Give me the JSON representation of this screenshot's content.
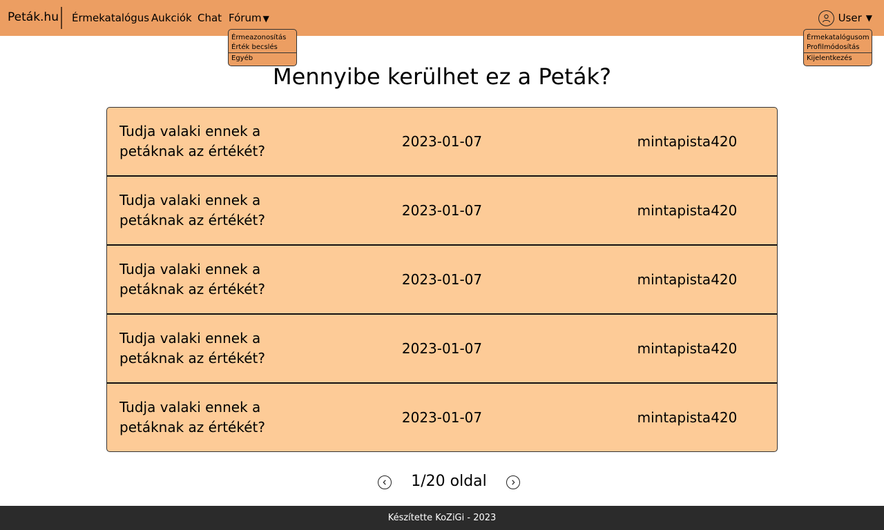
{
  "header": {
    "brand": "Peták.hu",
    "nav": [
      "Érmekatalógus",
      "Aukciók",
      "Chat",
      "Fórum"
    ],
    "forum_arrow": "▼",
    "user_label": "User",
    "user_arrow": "▼"
  },
  "forum_menu": {
    "items": [
      "Érmeazonosítás",
      "Érték becslés"
    ],
    "last": "Egyéb"
  },
  "user_menu": {
    "items": [
      "Érmekatalógusom",
      "Profilmódosítás"
    ],
    "last": "Kijelentkezés"
  },
  "main": {
    "title": "Mennyibe kerülhet ez a Peták?",
    "posts": [
      {
        "title": "Tudja valaki ennek a petáknak az értékét?",
        "date": "2023-01-07",
        "user": "mintapista420"
      },
      {
        "title": "Tudja valaki ennek a petáknak az értékét?",
        "date": "2023-01-07",
        "user": "mintapista420"
      },
      {
        "title": "Tudja valaki ennek a petáknak az értékét?",
        "date": "2023-01-07",
        "user": "mintapista420"
      },
      {
        "title": "Tudja valaki ennek a petáknak az értékét?",
        "date": "2023-01-07",
        "user": "mintapista420"
      },
      {
        "title": "Tudja valaki ennek a petáknak az értékét?",
        "date": "2023-01-07",
        "user": "mintapista420"
      }
    ]
  },
  "pagination": {
    "text": "1/20 oldal",
    "prev_icon": "chevron-left-icon",
    "next_icon": "chevron-right-icon"
  },
  "footer": {
    "text": "Készítette KoZiGi - 2023"
  },
  "colors": {
    "navbar": "#ec9e62",
    "row_background": "#fdcb97",
    "footer": "#2b2b2b"
  }
}
